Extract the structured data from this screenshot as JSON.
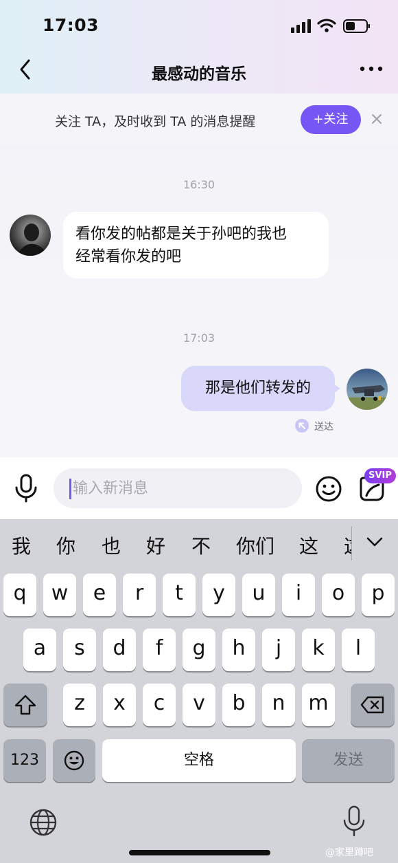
{
  "status_bar": {
    "time": "17:03"
  },
  "nav": {
    "title": "最感动的音乐"
  },
  "follow_banner": {
    "text": "关注 TA，及时收到 TA 的消息提醒",
    "button": "+关注"
  },
  "messages": [
    {
      "time": "16:30",
      "direction": "incoming",
      "text_line1": "看你发的帖都是关于孙吧的我也",
      "text_line2": "经常看你发的吧"
    },
    {
      "time": "17:03",
      "direction": "outgoing",
      "text": "那是他们转发的",
      "status": "送达"
    }
  ],
  "input": {
    "placeholder": "输入新消息",
    "badge": "SVIP"
  },
  "keyboard": {
    "candidates": [
      "我",
      "你",
      "也",
      "好",
      "不",
      "你们",
      "这",
      "这"
    ],
    "row1": [
      "q",
      "w",
      "e",
      "r",
      "t",
      "y",
      "u",
      "i",
      "o",
      "p"
    ],
    "row2": [
      "a",
      "s",
      "d",
      "f",
      "g",
      "h",
      "j",
      "k",
      "l"
    ],
    "row3": [
      "z",
      "x",
      "c",
      "v",
      "b",
      "n",
      "m"
    ],
    "numbers_key": "123",
    "space_key": "空格",
    "send_key": "发送"
  },
  "watermark": "@家里蹲吧",
  "colors": {
    "accent": "#7657f5",
    "outgoing_bubble": "#d9d8fb",
    "keyboard_bg": "#d3d4da"
  }
}
